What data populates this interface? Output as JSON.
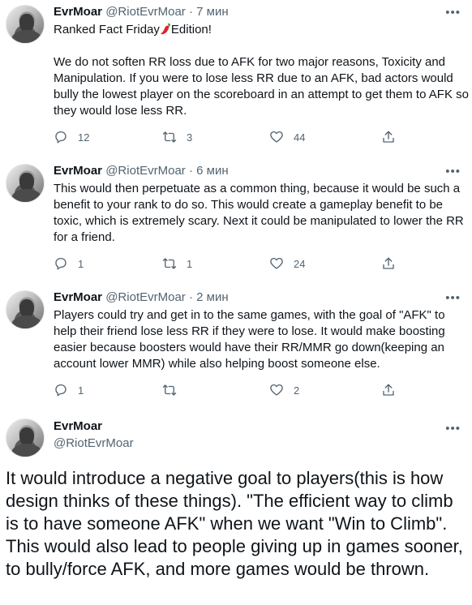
{
  "tweets": [
    {
      "name": "EvrMoar",
      "handle": "@RiotEvrMoar",
      "dot": "·",
      "time": "7 мин",
      "title_before": "Ranked Fact Friday",
      "title_after": "Edition!",
      "body": "We do not soften RR loss due to AFK for two major reasons, Toxicity and Manipulation. If you were to lose less RR due to an AFK, bad actors would bully the lowest player on the scoreboard in an attempt to get them to AFK so they would lose less RR.",
      "replies": "12",
      "retweets": "3",
      "likes": "44"
    },
    {
      "name": "EvrMoar",
      "handle": "@RiotEvrMoar",
      "dot": "·",
      "time": "6 мин",
      "body": "This would then perpetuate as a common thing, because it would be such a benefit to your rank to do so. This would create a gameplay benefit to be toxic, which is extremely scary. Next it could be manipulated to lower the RR for a friend.",
      "replies": "1",
      "retweets": "1",
      "likes": "24"
    },
    {
      "name": "EvrMoar",
      "handle": "@RiotEvrMoar",
      "dot": "·",
      "time": "2 мин",
      "body": "Players could try and get in to the same games, with the goal of \"AFK\" to help their friend lose less RR if they were to lose. It would make boosting easier because boosters would have their RR/MMR go down(keeping an account lower MMR) while also helping boost someone else.",
      "replies": "1",
      "retweets": "",
      "likes": "2"
    },
    {
      "name": "EvrMoar",
      "handle": "@RiotEvrMoar",
      "body": "It would introduce a negative goal to players(this is how design thinks of these things). \"The efficient way to climb is to have someone AFK\" when we want \"Win to Climb\". This would also lead to people giving up in games sooner, to bully/force AFK, and more games would be thrown."
    }
  ],
  "icons": {
    "more": "more-horizontal-icon",
    "reply": "reply-icon",
    "retweet": "retweet-icon",
    "like": "heart-icon",
    "share": "share-icon",
    "emoji": "chili-pepper-emoji"
  },
  "colors": {
    "text": "#0f1419",
    "secondary": "#536471",
    "background": "#ffffff"
  }
}
